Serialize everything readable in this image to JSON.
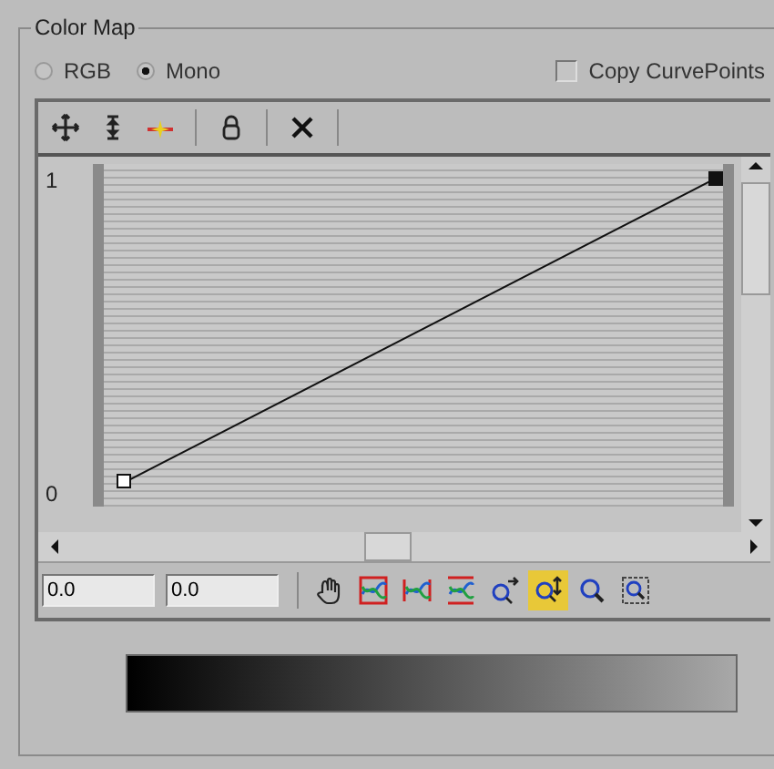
{
  "group": {
    "title": "Color Map"
  },
  "modes": [
    {
      "label": "RGB",
      "selected": false
    },
    {
      "label": "Mono",
      "selected": true
    }
  ],
  "copy_curve_points": {
    "label": "Copy CurvePoints",
    "checked": false
  },
  "toolbar": [
    {
      "kind": "move"
    },
    {
      "kind": "scale"
    },
    {
      "kind": "insert"
    },
    {
      "kind": "sep"
    },
    {
      "kind": "lock"
    },
    {
      "kind": "sep"
    },
    {
      "kind": "delete"
    },
    {
      "kind": "sep"
    }
  ],
  "graph": {
    "axis_labels": [
      "1",
      "0"
    ]
  },
  "fields": [
    {
      "value": "0.0"
    },
    {
      "value": "0.0"
    }
  ],
  "view_tools": [
    {
      "kind": "pan",
      "selected": false
    },
    {
      "kind": "fit",
      "selected": false
    },
    {
      "kind": "fit-h",
      "selected": false
    },
    {
      "kind": "fit-v",
      "selected": false
    },
    {
      "kind": "zoom-h",
      "selected": false
    },
    {
      "kind": "zoom-v",
      "selected": true
    },
    {
      "kind": "zoom",
      "selected": false
    },
    {
      "kind": "zoom-region",
      "selected": false
    }
  ]
}
